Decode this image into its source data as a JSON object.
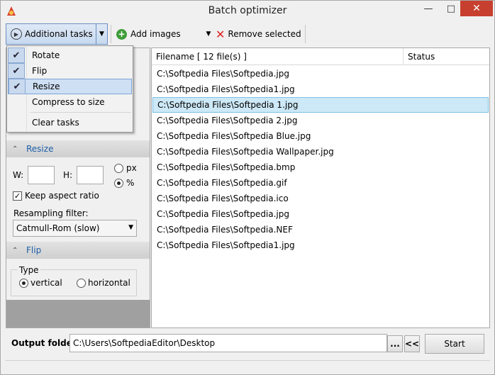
{
  "window": {
    "title": "Batch optimizer"
  },
  "toolbar": {
    "additional_tasks": "Additional tasks",
    "add_images": "Add images",
    "remove_selected": "Remove selected"
  },
  "menu": {
    "items": [
      {
        "label": "Rotate",
        "checked": true
      },
      {
        "label": "Flip",
        "checked": true
      },
      {
        "label": "Resize",
        "checked": true
      },
      {
        "label": "Compress to size",
        "checked": false
      },
      {
        "label": "Clear tasks",
        "checked": false
      }
    ]
  },
  "resize": {
    "header": "Resize",
    "w_label": "W:",
    "h_label": "H:",
    "w_value": "",
    "h_value": "",
    "unit_px": "px",
    "unit_pct": "%",
    "selected_unit": "%",
    "keep_aspect": "Keep aspect ratio",
    "keep_aspect_checked": true,
    "resampling_label": "Resampling filter:",
    "resampling_value": "Catmull-Rom (slow)"
  },
  "flip": {
    "header": "Flip",
    "type_label": "Type",
    "vertical": "vertical",
    "horizontal": "horizontal",
    "selected": "vertical"
  },
  "files": {
    "header_name": "Filename [ 12 file(s) ]",
    "header_status": "Status",
    "selected_index": 2,
    "rows": [
      "C:\\Softpedia Files\\Softpedia.jpg",
      "C:\\Softpedia Files\\Softpedia1.jpg",
      "C:\\Softpedia Files\\Softpedia 1.jpg",
      "C:\\Softpedia Files\\Softpedia 2.jpg",
      "C:\\Softpedia Files\\Softpedia Blue.jpg",
      "C:\\Softpedia Files\\Softpedia Wallpaper.jpg",
      "C:\\Softpedia Files\\Softpedia.bmp",
      "C:\\Softpedia Files\\Softpedia.gif",
      "C:\\Softpedia Files\\Softpedia.ico",
      "C:\\Softpedia Files\\Softpedia.jpg",
      "C:\\Softpedia Files\\Softpedia.NEF",
      "C:\\Softpedia Files\\Softpedia1.jpg"
    ]
  },
  "output": {
    "label": "Output folder:",
    "path": "C:\\Users\\SoftpediaEditor\\Desktop",
    "browse": "...",
    "back": "<<",
    "start": "Start"
  },
  "colors": {
    "accent": "#1f5fa8",
    "selection": "#cde8f6",
    "close": "#c7402f"
  }
}
